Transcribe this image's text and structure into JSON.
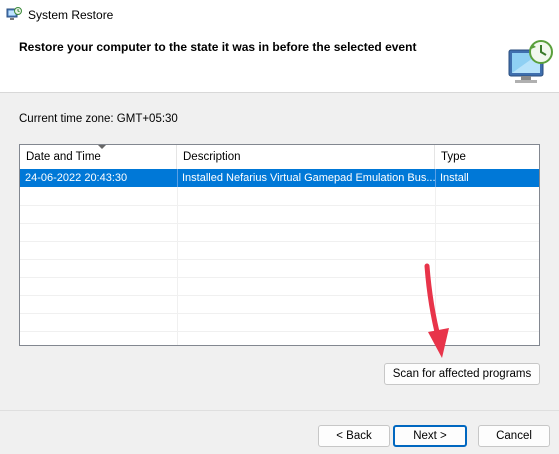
{
  "window": {
    "title": "System Restore",
    "icon": "system-restore-icon"
  },
  "header": {
    "title": "Restore your computer to the state it was in before the selected event",
    "graphic": "monitor-restore-icon"
  },
  "timezone_label": "Current time zone: GMT+05:30",
  "table": {
    "columns": [
      "Date and Time",
      "Description",
      "Type"
    ],
    "sorted_column": "Date and Time",
    "rows": [
      {
        "date_time": "24-06-2022 20:43:30",
        "description": "Installed Nefarius Virtual Gamepad Emulation Bus...",
        "type": "Install",
        "selected": true
      }
    ]
  },
  "buttons": {
    "scan": "Scan for affected programs",
    "back": "< Back",
    "next": "Next >",
    "cancel": "Cancel"
  },
  "colors": {
    "selection": "#0078d7",
    "arrow": "#e8344a"
  }
}
